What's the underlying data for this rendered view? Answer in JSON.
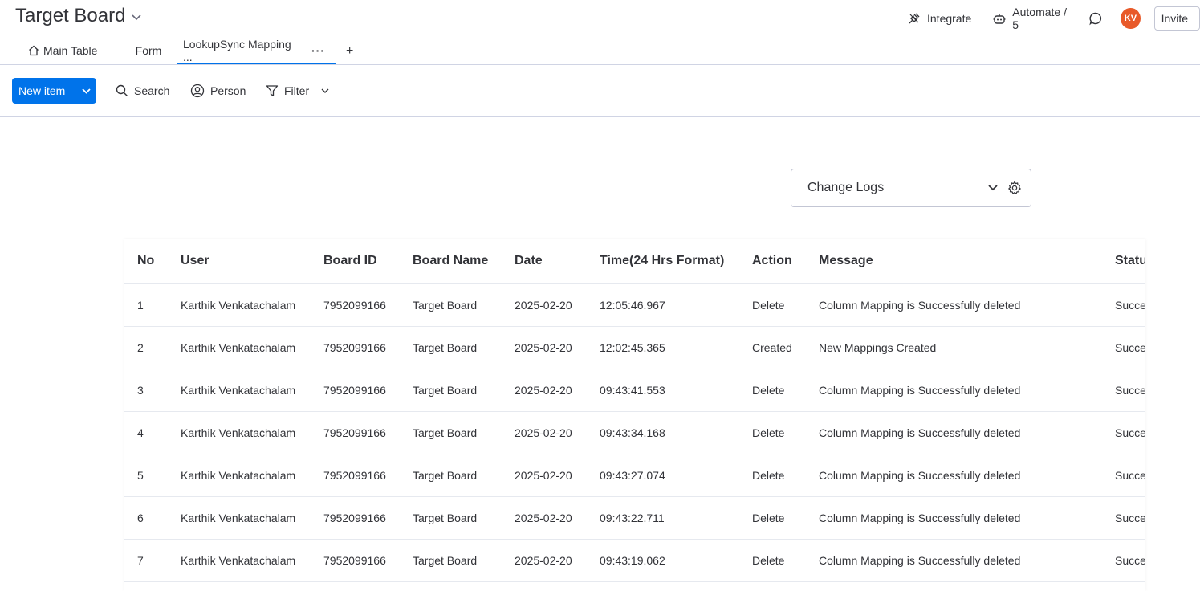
{
  "header": {
    "board_title": "Target Board",
    "integrate_label": "Integrate",
    "automate_label": "Automate / 5",
    "avatar_initials": "KV",
    "invite_label": "Invite"
  },
  "tabs": [
    {
      "label": "Main Table",
      "icon": "home-icon"
    },
    {
      "label": "Form"
    },
    {
      "label": "LookupSync Mapping ...",
      "active": true
    }
  ],
  "toolbar": {
    "new_item_label": "New item",
    "search_label": "Search",
    "person_label": "Person",
    "filter_label": "Filter"
  },
  "log_selector": {
    "value": "Change Logs"
  },
  "table": {
    "columns": [
      "No",
      "User",
      "Board ID",
      "Board Name",
      "Date",
      "Time(24 Hrs Format)",
      "Action",
      "Message",
      "Status"
    ],
    "rows": [
      [
        "1",
        "Karthik Venkatachalam",
        "7952099166",
        "Target Board",
        "2025-02-20",
        "12:05:46.967",
        "Delete",
        "Column Mapping is Successfully deleted",
        "Success"
      ],
      [
        "2",
        "Karthik Venkatachalam",
        "7952099166",
        "Target Board",
        "2025-02-20",
        "12:02:45.365",
        "Created",
        "New Mappings Created",
        "Success"
      ],
      [
        "3",
        "Karthik Venkatachalam",
        "7952099166",
        "Target Board",
        "2025-02-20",
        "09:43:41.553",
        "Delete",
        "Column Mapping is Successfully deleted",
        "Success"
      ],
      [
        "4",
        "Karthik Venkatachalam",
        "7952099166",
        "Target Board",
        "2025-02-20",
        "09:43:34.168",
        "Delete",
        "Column Mapping is Successfully deleted",
        "Success"
      ],
      [
        "5",
        "Karthik Venkatachalam",
        "7952099166",
        "Target Board",
        "2025-02-20",
        "09:43:27.074",
        "Delete",
        "Column Mapping is Successfully deleted",
        "Success"
      ],
      [
        "6",
        "Karthik Venkatachalam",
        "7952099166",
        "Target Board",
        "2025-02-20",
        "09:43:22.711",
        "Delete",
        "Column Mapping is Successfully deleted",
        "Success"
      ],
      [
        "7",
        "Karthik Venkatachalam",
        "7952099166",
        "Target Board",
        "2025-02-20",
        "09:43:19.062",
        "Delete",
        "Column Mapping is Successfully deleted",
        "Success"
      ]
    ]
  },
  "colors": {
    "accent": "#0073ea",
    "avatar": "#e85a2a",
    "text": "#323338"
  }
}
